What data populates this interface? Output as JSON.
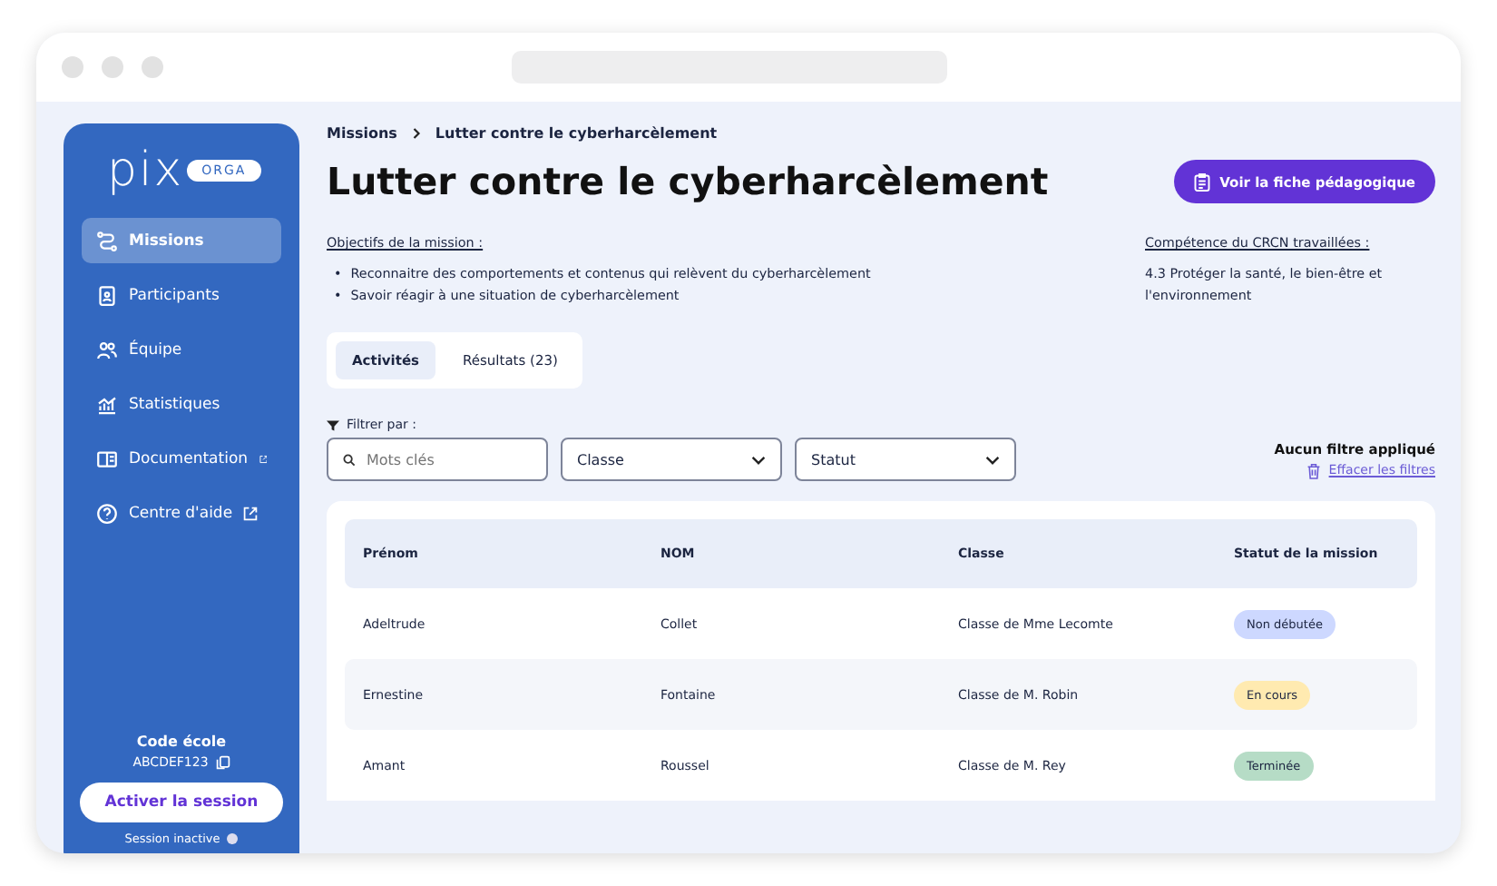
{
  "sidebar": {
    "logo": "pix",
    "logo_badge": "ORGA",
    "items": [
      {
        "label": "Missions",
        "selected": true,
        "external": false
      },
      {
        "label": "Participants",
        "selected": false,
        "external": false
      },
      {
        "label": "Équipe",
        "selected": false,
        "external": false
      },
      {
        "label": "Statistiques",
        "selected": false,
        "external": false
      },
      {
        "label": "Documentation",
        "selected": false,
        "external": true
      },
      {
        "label": "Centre d'aide",
        "selected": false,
        "external": true
      }
    ],
    "code_label": "Code école",
    "code": "ABCDEF123",
    "activate_button": "Activer la session",
    "session_status": "Session inactive"
  },
  "breadcrumb": [
    "Missions",
    "Lutter contre le cyberharcèlement"
  ],
  "title": "Lutter contre le cyberharcèlement",
  "sheet_button": "Voir la fiche pédagogique",
  "objectives": {
    "heading": "Objectifs de la mission :",
    "items": [
      {
        "marker": "•",
        "text": "Reconnaitre des comportements et contenus qui relèvent du cyberharcèlement"
      },
      {
        "marker": "•",
        "text": "Savoir réagir à une situation de cyberharcèlement"
      }
    ]
  },
  "competence": {
    "heading": "Compétence du CRCN travaillées :",
    "text": "4.3 Protéger la santé, le bien-être et l'environnement"
  },
  "tabs": [
    {
      "label": "Activités",
      "selected": true
    },
    {
      "label": "Résultats (23)",
      "selected": false
    }
  ],
  "filters": {
    "label": "Filtrer par :",
    "search_placeholder": "Mots clés",
    "selects": [
      "Classe",
      "Statut"
    ],
    "status": "Aucun filtre appliqué",
    "clear": "Effacer les filtres"
  },
  "table": {
    "columns": [
      "Prénom",
      "NOM",
      "Classe",
      "Statut de la mission"
    ],
    "rows": [
      {
        "cells": [
          "Adeltrude",
          "Collet",
          "Classe de Mme Lecomte"
        ],
        "status": "Non débutée",
        "color": "#cdd8ff"
      },
      {
        "cells": [
          "Ernestine",
          "Fontaine",
          "Classe de M. Robin"
        ],
        "status": "En cours",
        "color": "#ffeab0"
      },
      {
        "cells": [
          "Amant",
          "Roussel",
          "Classe de M. Rey"
        ],
        "status": "Terminée",
        "color": "#b6dcc6"
      }
    ]
  }
}
